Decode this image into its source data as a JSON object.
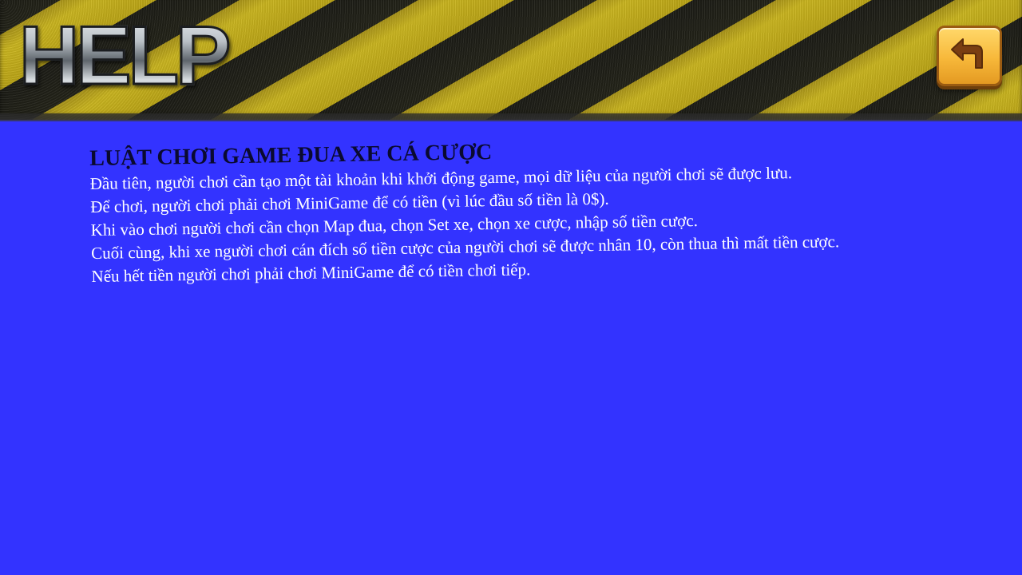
{
  "header": {
    "title": "HELP",
    "back_icon": "back-arrow-icon",
    "colors": {
      "stripe_yellow": "#c9b420",
      "stripe_dark": "#1c1c16",
      "back_button": "#f7b83a"
    }
  },
  "rules": {
    "title": "LUẬT CHƠI GAME ĐUA XE CÁ CƯỢC",
    "lines": [
      "Đầu tiên, người chơi cần tạo một tài khoản khi khởi động game, mọi dữ liệu của người chơi sẽ được lưu.",
      "Để chơi, người chơi phải chơi MiniGame để có tiền (vì lúc đầu số tiền là 0$).",
      "Khi vào chơi người chơi cần chọn Map đua, chọn Set xe, chọn xe cược, nhập số tiền cược.",
      "Cuối cùng, khi xe người chơi cán đích số tiền cược của người chơi sẽ được nhân 10, còn thua thì mất tiền cược.",
      "Nếu hết tiền người chơi phải chơi MiniGame để có tiền chơi tiếp."
    ]
  },
  "background_color": "#3333ff"
}
